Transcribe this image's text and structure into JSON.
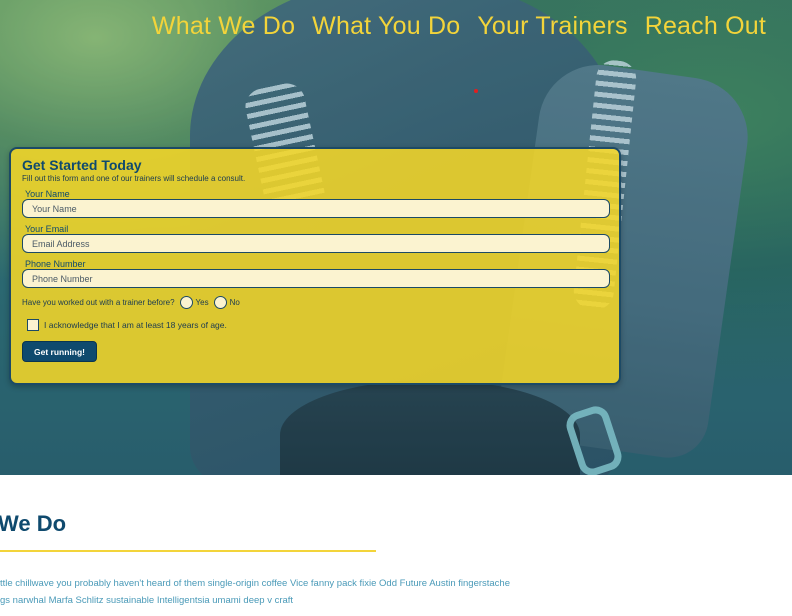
{
  "nav": {
    "items": [
      {
        "label": "What We Do"
      },
      {
        "label": "What You Do"
      },
      {
        "label": "Your Trainers"
      },
      {
        "label": "Reach Out"
      }
    ]
  },
  "form": {
    "title": "Get Started Today",
    "subtitle": "Fill out this form and one of our trainers will schedule a consult.",
    "name": {
      "label": "Your Name",
      "placeholder": "Your Name"
    },
    "email": {
      "label": "Your Email",
      "placeholder": "Email Address"
    },
    "phone": {
      "label": "Phone Number",
      "placeholder": "Phone Number"
    },
    "question": "Have you worked out with a trainer before?",
    "yes_label": "Yes",
    "no_label": "No",
    "acknowledge_label": "I acknowledge that I am at least 18 years of age.",
    "submit_label": "Get running!"
  },
  "section": {
    "title": "We Do",
    "line1": "ttle chillwave you probably haven't heard of them single-origin coffee Vice fanny pack fixie Odd Future Austin fingerstache",
    "line2": "gs narwhal Marfa Schlitz sustainable Intelligentsia umami deep v craft"
  },
  "colors": {
    "accent_yellow": "#f3d43a",
    "brand_blue": "#0f4a6e",
    "link_text": "#4a9ab8"
  }
}
